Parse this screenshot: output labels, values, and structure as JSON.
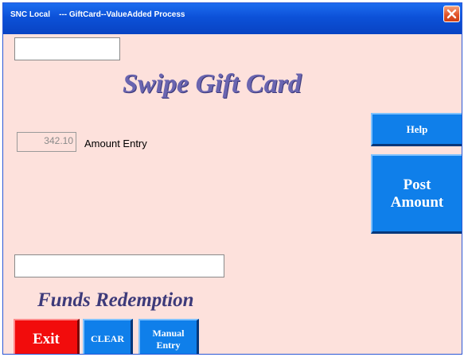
{
  "window": {
    "title": "SNC Local    --- GiftCard--ValueAdded Process",
    "close_icon": "close-icon",
    "colors": {
      "titlebar": "#0c51d8",
      "background": "#fde1dc",
      "close": "#e2552a"
    }
  },
  "top_input": {
    "value": "",
    "placeholder": ""
  },
  "heading": "Swipe Gift Card",
  "amount": {
    "value": "342.10",
    "label": "Amount Entry"
  },
  "bottom_input": {
    "value": "",
    "placeholder": ""
  },
  "section_title": "Funds Redemption",
  "buttons": {
    "help": "Help",
    "post_line1": "Post",
    "post_line2": "Amount",
    "exit": "Exit",
    "clear": "CLEAR",
    "manual_line1": "Manual",
    "manual_line2": "Entry"
  },
  "colors": {
    "button_blue": "#0f7fea",
    "button_red": "#f20c0c",
    "title_purple": "#6a65b0"
  }
}
